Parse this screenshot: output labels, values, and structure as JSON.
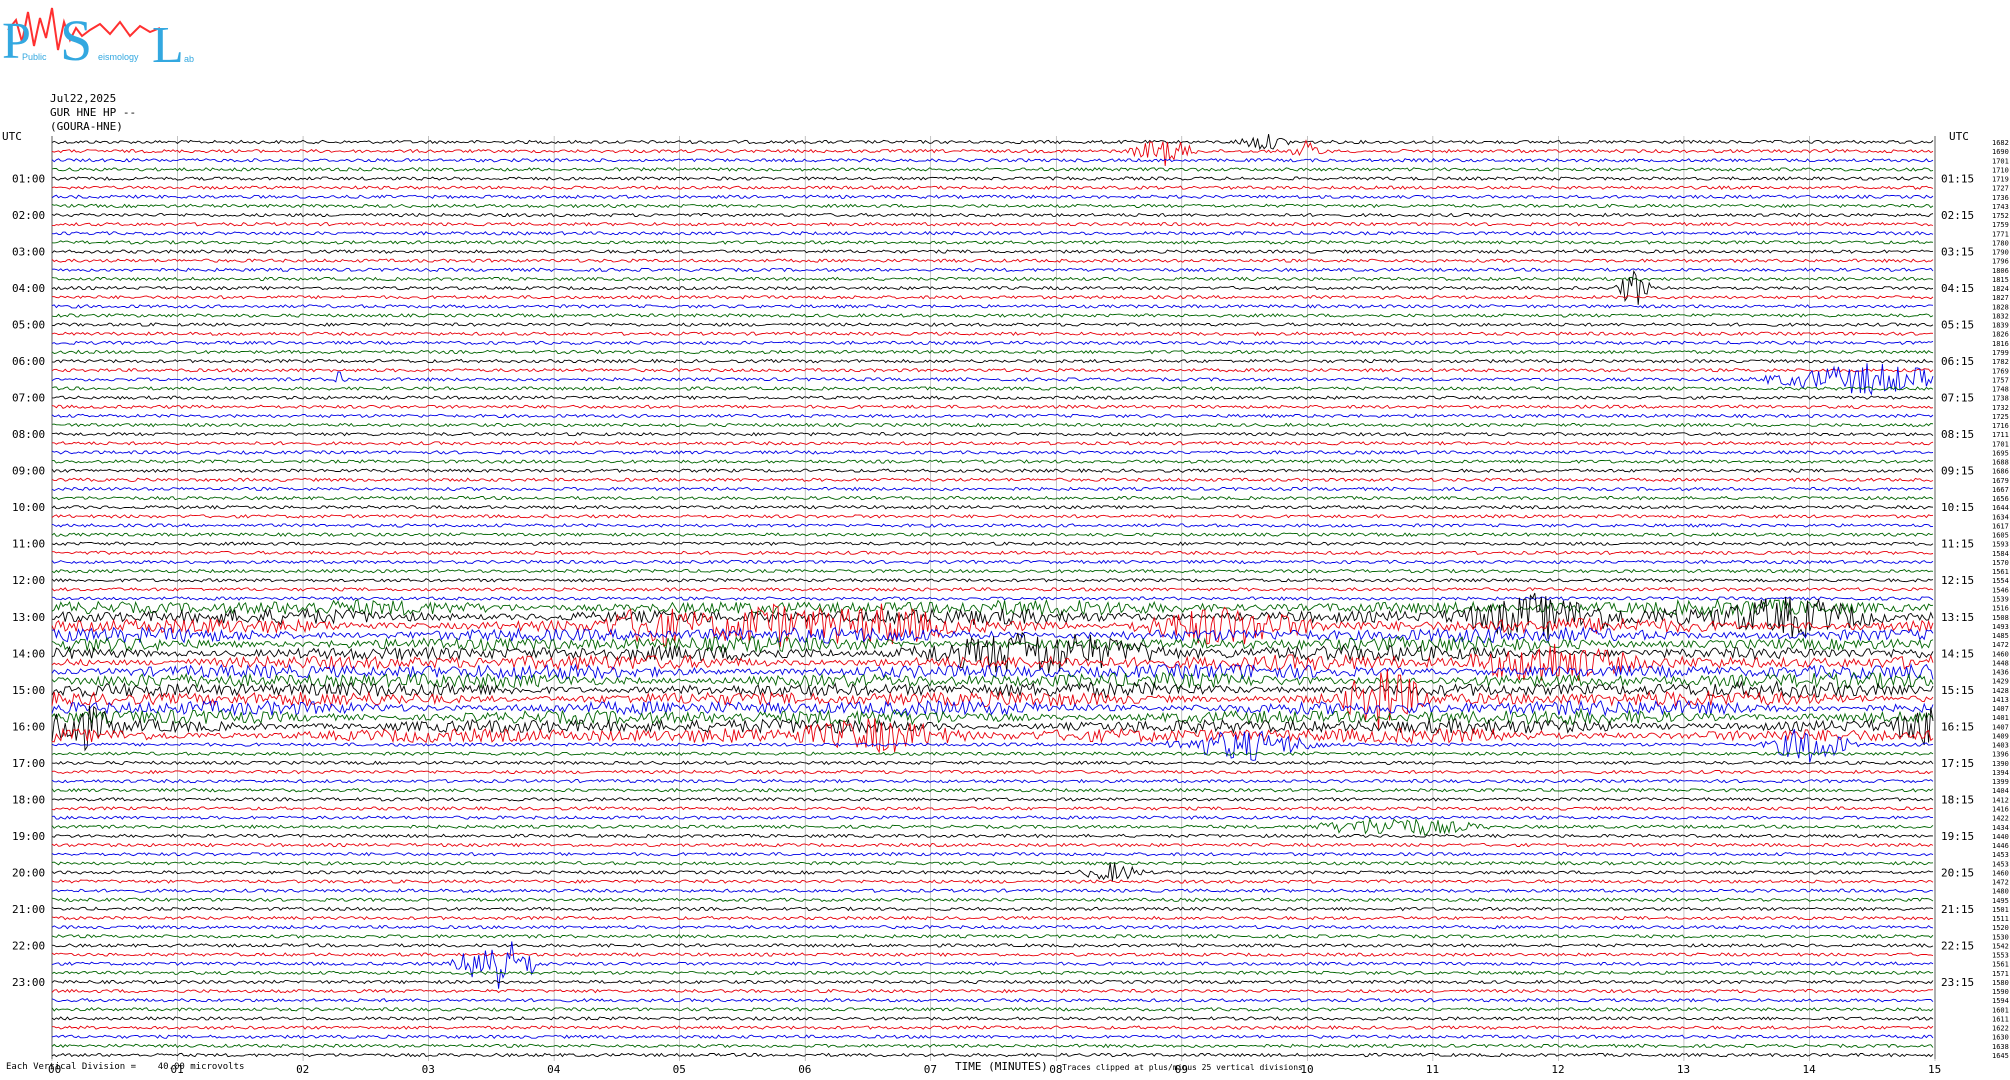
{
  "logo": {
    "letters": [
      "P",
      "S",
      "L"
    ],
    "subtext": [
      "Public",
      "eismology",
      "ab"
    ]
  },
  "header": {
    "date": "Jul22,2025",
    "line2": "GUR HNE HP --",
    "line3": "(GOURA-HNE)"
  },
  "footer": {
    "left_text": "Each Vertical Division =    40.00 microvolts",
    "xlabel": "TIME (MINUTES)",
    "clip_note": "Traces clipped at plus/minus 25 vertical divisions"
  },
  "chart_data": {
    "type": "line",
    "left_axis_label": "UTC",
    "right_axis_label": "UTC",
    "x_ticks": [
      "00",
      "01",
      "02",
      "03",
      "04",
      "05",
      "06",
      "07",
      "08",
      "09",
      "10",
      "11",
      "12",
      "13",
      "14",
      "15"
    ],
    "xlim": [
      0,
      15
    ],
    "rows_per_hour": 4,
    "left_hour_labels": [
      "01:00",
      "02:00",
      "03:00",
      "04:00",
      "05:00",
      "06:00",
      "07:00",
      "08:00",
      "09:00",
      "10:00",
      "11:00",
      "12:00",
      "13:00",
      "14:00",
      "15:00",
      "16:00",
      "17:00",
      "18:00",
      "19:00",
      "20:00",
      "21:00",
      "22:00",
      "23:00"
    ],
    "right_hour_labels": [
      "01:15",
      "02:15",
      "03:15",
      "04:15",
      "05:15",
      "06:15",
      "07:15",
      "08:15",
      "09:15",
      "10:15",
      "11:15",
      "12:15",
      "13:15",
      "14:15",
      "15:15",
      "16:15",
      "17:15",
      "18:15",
      "19:15",
      "20:15",
      "21:15",
      "22:15",
      "23:15"
    ],
    "trace_colors": [
      "#000000",
      "#e8000b",
      "#0000e6",
      "#006400"
    ],
    "right_values": [
      "1682",
      "1690",
      "1701",
      "1710",
      "1719",
      "1727",
      "1736",
      "1743",
      "1752",
      "1759",
      "1771",
      "1780",
      "1790",
      "1796",
      "1806",
      "1815",
      "1824",
      "1827",
      "1828",
      "1832",
      "1839",
      "1826",
      "1816",
      "1799",
      "1782",
      "1769",
      "1757",
      "1748",
      "1738",
      "1732",
      "1725",
      "1716",
      "1711",
      "1701",
      "1695",
      "1688",
      "1686",
      "1679",
      "1667",
      "1656",
      "1644",
      "1634",
      "1617",
      "1605",
      "1593",
      "1584",
      "1570",
      "1561",
      "1554",
      "1546",
      "1539",
      "1516",
      "1508",
      "1493",
      "1485",
      "1472",
      "1460",
      "1448",
      "1436",
      "1429",
      "1428",
      "1413",
      "1407",
      "1401",
      "1407",
      "1409",
      "1403",
      "1396",
      "1390",
      "1394",
      "1399",
      "1404",
      "1412",
      "1416",
      "1422",
      "1434",
      "1440",
      "1446",
      "1453",
      "1453",
      "1460",
      "1472",
      "1480",
      "1495",
      "1501",
      "1511",
      "1520",
      "1530",
      "1542",
      "1553",
      "1561",
      "1571",
      "1580",
      "1590",
      "1594",
      "1601",
      "1611",
      "1622",
      "1630",
      "1638",
      "1645"
    ],
    "events": [
      {
        "row": 1,
        "minute": 8.85,
        "amp": 14,
        "dur": 0.3
      },
      {
        "row": 0,
        "minute": 9.65,
        "amp": 8,
        "dur": 0.25
      },
      {
        "row": 1,
        "minute": 10.0,
        "amp": 10,
        "dur": 0.15
      },
      {
        "row": 16,
        "minute": 12.6,
        "amp": 22,
        "dur": 0.15
      },
      {
        "row": 26,
        "minute": 14.5,
        "amp": 16,
        "dur": 1.0
      },
      {
        "row": 26,
        "minute": 2.3,
        "amp": 14,
        "dur": 0.05
      },
      {
        "row": 53,
        "minute": 4.8,
        "amp": 18,
        "dur": 0.5
      },
      {
        "row": 53,
        "minute": 5.7,
        "amp": 20,
        "dur": 0.7
      },
      {
        "row": 53,
        "minute": 6.6,
        "amp": 16,
        "dur": 0.6
      },
      {
        "row": 53,
        "minute": 9.3,
        "amp": 18,
        "dur": 0.8
      },
      {
        "row": 52,
        "minute": 11.8,
        "amp": 20,
        "dur": 0.8
      },
      {
        "row": 52,
        "minute": 13.9,
        "amp": 18,
        "dur": 0.8
      },
      {
        "row": 56,
        "minute": 7.8,
        "amp": 20,
        "dur": 1.2
      },
      {
        "row": 57,
        "minute": 11.9,
        "amp": 22,
        "dur": 0.8
      },
      {
        "row": 61,
        "minute": 10.6,
        "amp": 30,
        "dur": 0.4
      },
      {
        "row": 64,
        "minute": 0.15,
        "amp": 24,
        "dur": 0.4
      },
      {
        "row": 66,
        "minute": 9.5,
        "amp": 16,
        "dur": 0.7
      },
      {
        "row": 66,
        "minute": 14.0,
        "amp": 20,
        "dur": 0.4
      },
      {
        "row": 64,
        "minute": 15.0,
        "amp": 18,
        "dur": 0.4
      },
      {
        "row": 65,
        "minute": 6.6,
        "amp": 16,
        "dur": 0.8
      },
      {
        "row": 75,
        "minute": 10.7,
        "amp": 10,
        "dur": 0.8
      },
      {
        "row": 80,
        "minute": 8.45,
        "amp": 9,
        "dur": 0.3
      },
      {
        "row": 90,
        "minute": 3.55,
        "amp": 30,
        "dur": 0.4
      }
    ],
    "active_rows": [
      51,
      52,
      53,
      54,
      55,
      56,
      57,
      58,
      59,
      60,
      61,
      62,
      63,
      64,
      65
    ]
  }
}
